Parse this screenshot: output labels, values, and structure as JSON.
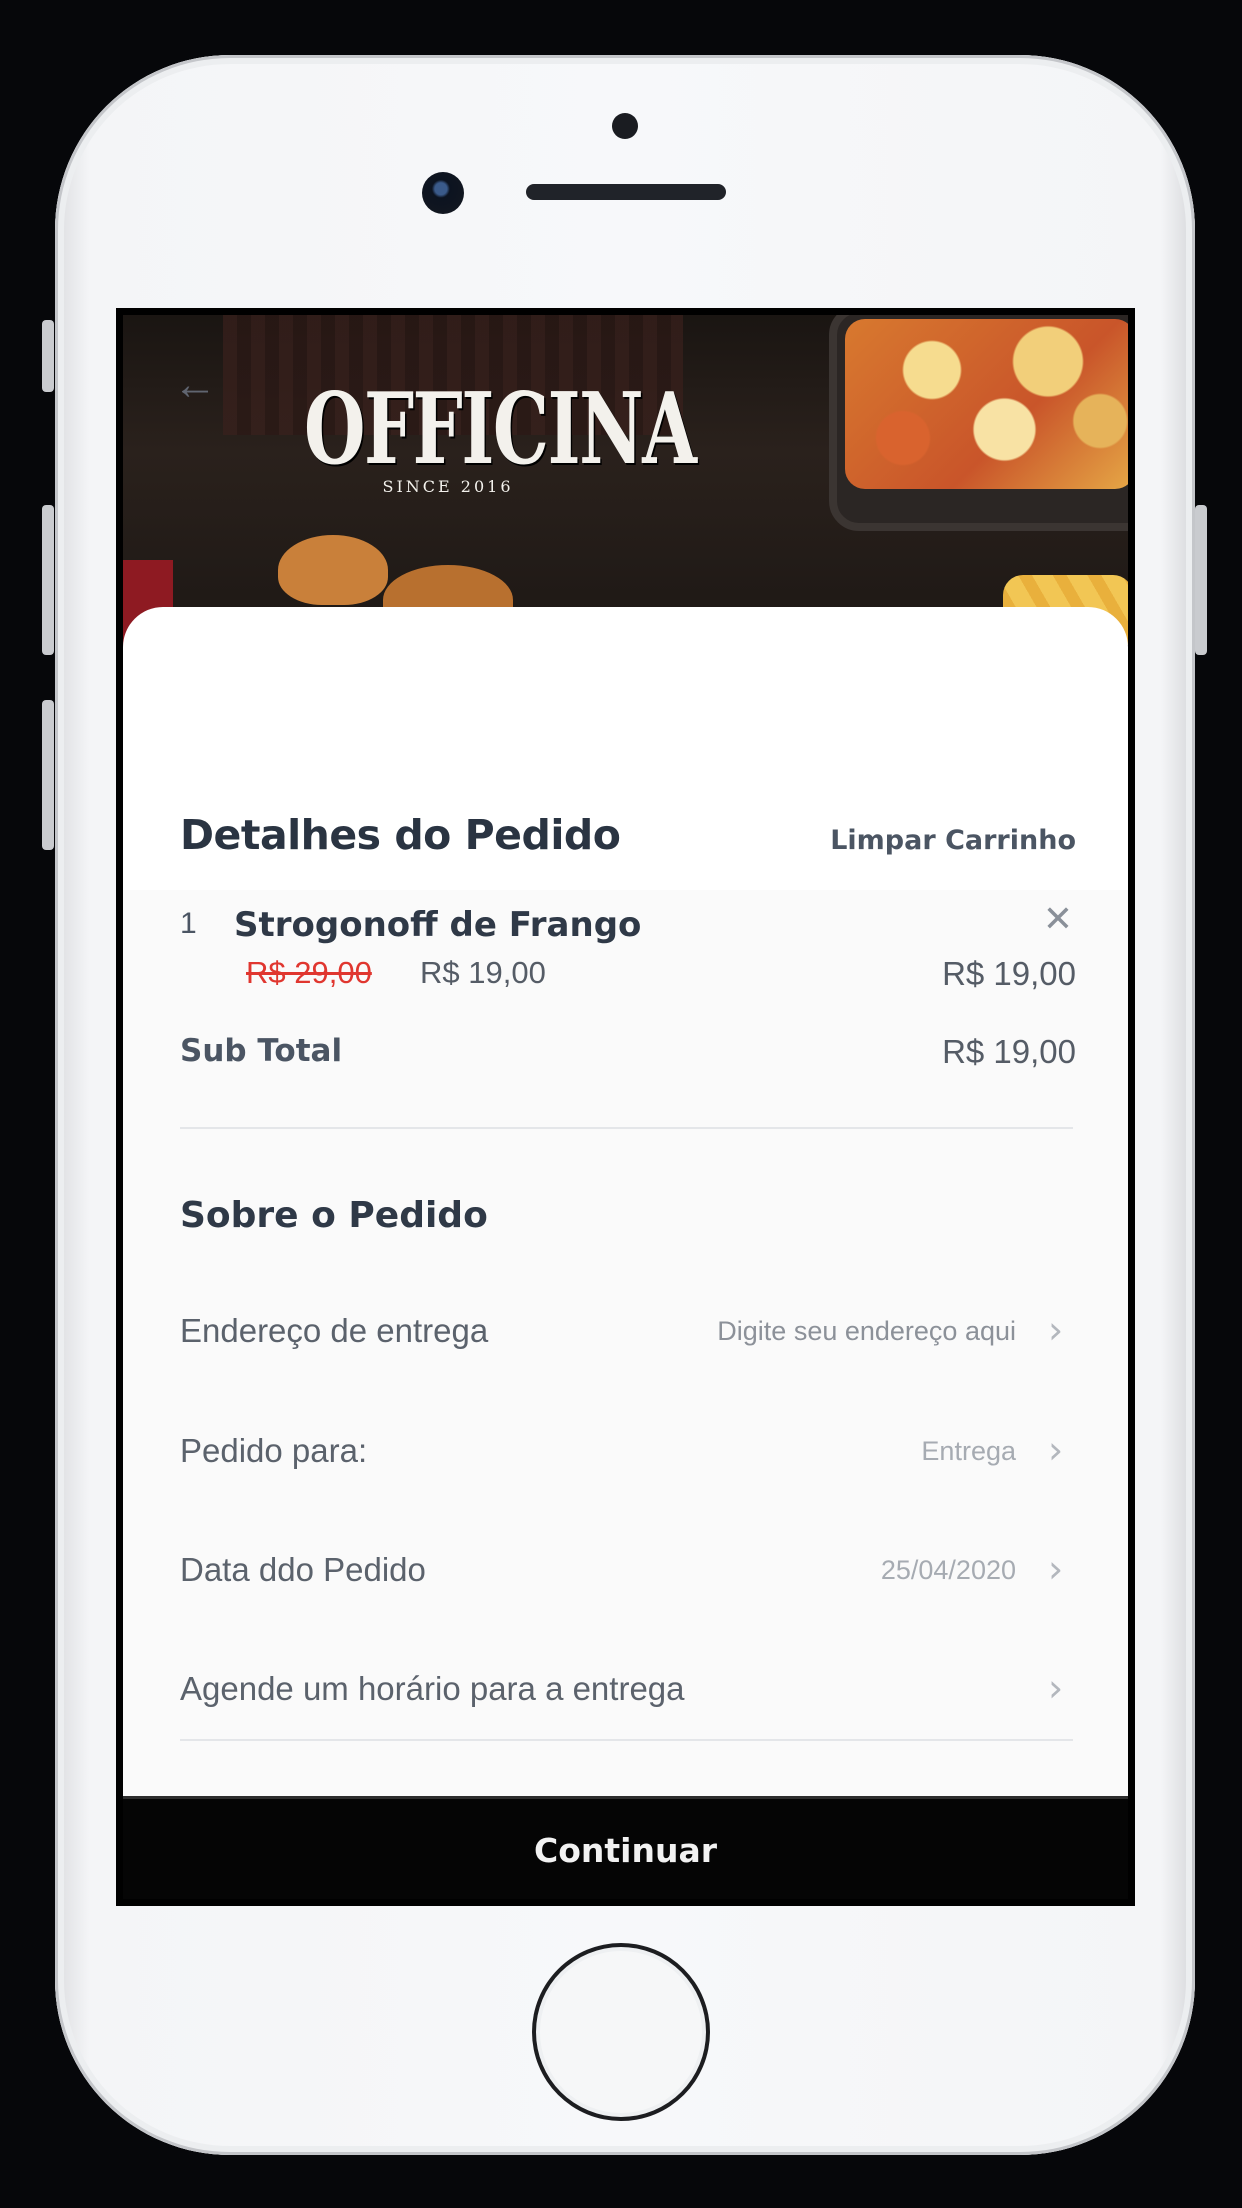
{
  "restaurant": {
    "logo_text": "OFFICINA",
    "logo_since": "SINCE 2016"
  },
  "order_details": {
    "title": "Detalhes do Pedido",
    "clear_cart_label": "Limpar Carrinho",
    "items": [
      {
        "quantity": "1",
        "name": "Strogonoff de Frango",
        "original_price": "R$ 29,00",
        "price": "R$ 19,00",
        "line_total": "R$ 19,00"
      }
    ],
    "subtotal_label": "Sub Total",
    "subtotal_value": "R$ 19,00"
  },
  "about_order": {
    "title": "Sobre o Pedido",
    "rows": [
      {
        "label": "Endereço de entrega",
        "value": "Digite seu endereço aqui"
      },
      {
        "label": "Pedido para:",
        "value": "Entrega"
      },
      {
        "label": "Data ddo Pedido",
        "value": "25/04/2020"
      },
      {
        "label": "Agende um horário para a entrega",
        "value": ""
      }
    ]
  },
  "footer": {
    "continue_label": "Continuar"
  },
  "icons": {
    "back": "arrow-left-icon",
    "remove": "close-icon",
    "chevron": "chevron-right-icon"
  },
  "colors": {
    "price_strike": "#e0362f",
    "primary_button": "#050505",
    "heading": "#2a3442"
  }
}
